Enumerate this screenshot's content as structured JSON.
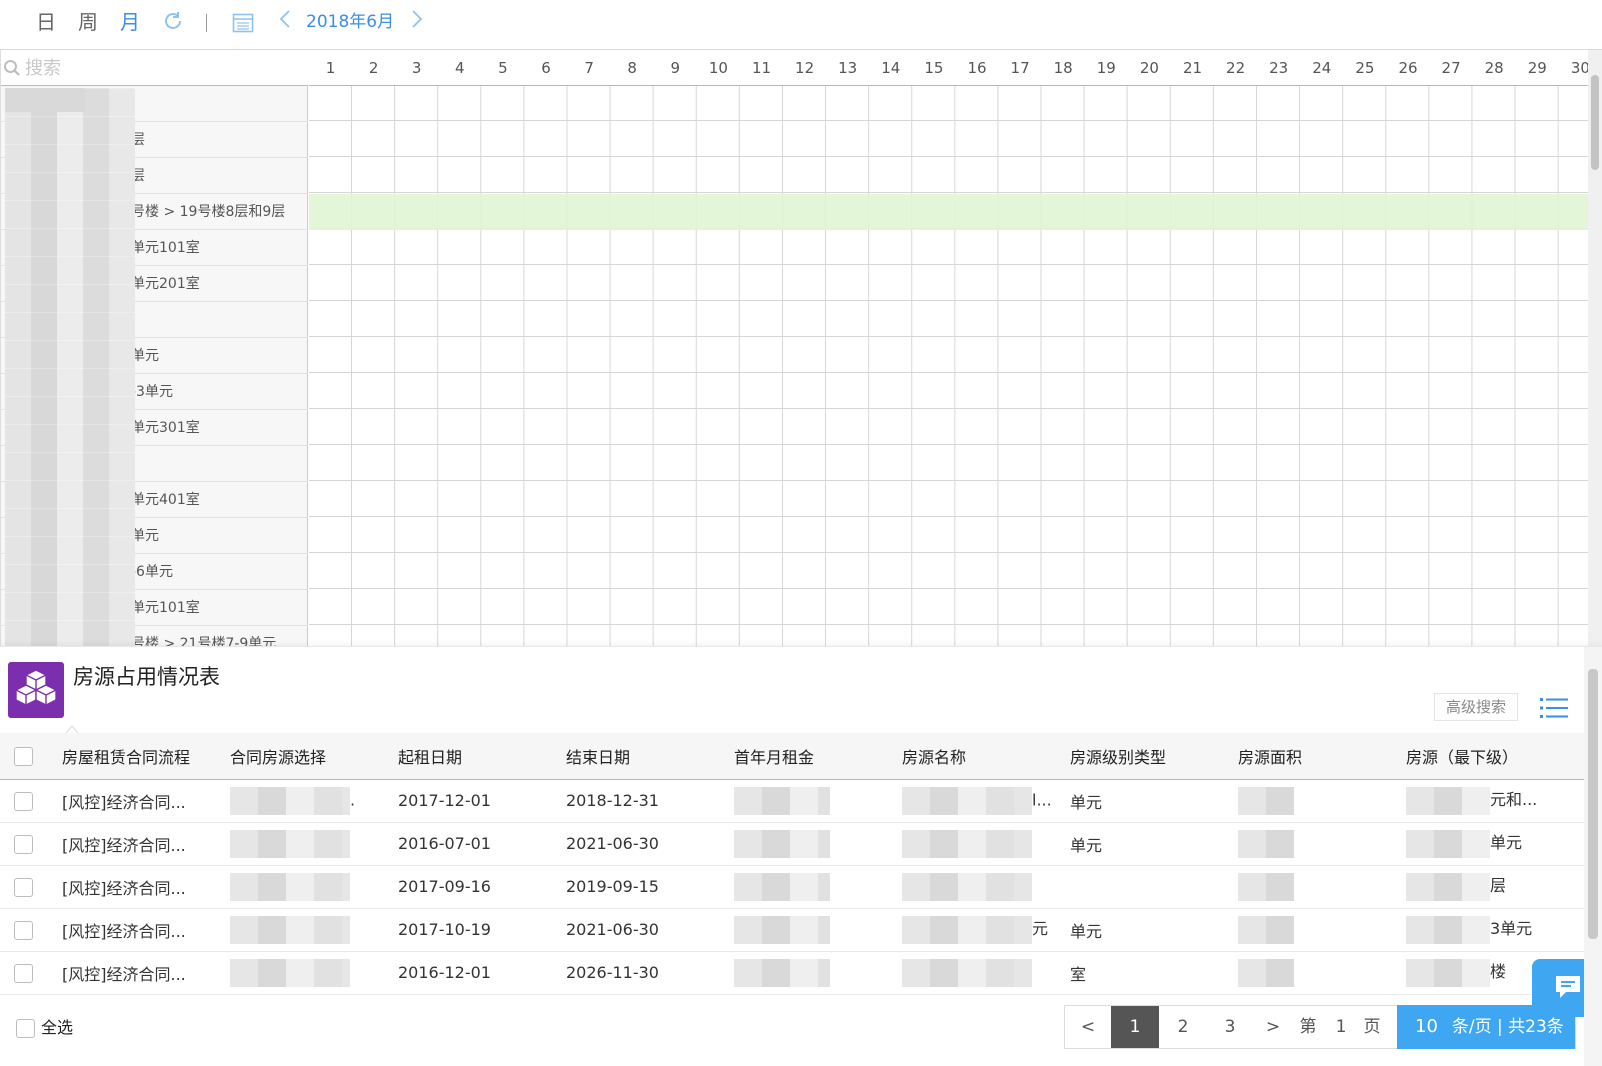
{
  "toolbar": {
    "view_day": "日",
    "view_week": "周",
    "view_month": "月",
    "month_label": "2018年6月",
    "prev": "‹",
    "next": "›"
  },
  "calendar": {
    "search_placeholder": "搜索",
    "days": [
      "1",
      "2",
      "3",
      "4",
      "5",
      "6",
      "7",
      "8",
      "9",
      "10",
      "11",
      "12",
      "13",
      "14",
      "15",
      "16",
      "17",
      "18",
      "19",
      "20",
      "21",
      "22",
      "23",
      "24",
      "25",
      "26",
      "27",
      "28",
      "29",
      "30"
    ],
    "rows": [
      "",
      "层",
      "层",
      "号楼 > 19号楼8层和9层",
      "单元101室",
      "单元201室",
      "",
      "单元",
      "-3单元",
      "单元301室",
      "",
      "单元401室",
      "单元",
      "-6单元",
      "单元101室",
      "号楼 > 21号楼7-9单元"
    ]
  },
  "panel": {
    "title": "房源占用情况表",
    "advanced_search": "高级搜索",
    "columns": [
      "房屋租赁合同流程",
      "合同房源选择",
      "起租日期",
      "结束日期",
      "首年月租金",
      "房源名称",
      "房源级别类型",
      "房源面积",
      "房源（最下级）"
    ],
    "rows": [
      {
        "flow": "[风控]经济合同...",
        "select_tail": ".",
        "start": "2017-12-01",
        "end": "2018-12-31",
        "name_tail": "l...",
        "level": "单元",
        "unit_tail": "元和..."
      },
      {
        "flow": "[风控]经济合同...",
        "select_tail": "",
        "start": "2016-07-01",
        "end": "2021-06-30",
        "name_tail": "",
        "level": "单元",
        "unit_tail": "单元"
      },
      {
        "flow": "[风控]经济合同...",
        "select_tail": "",
        "start": "2017-09-16",
        "end": "2019-09-15",
        "name_tail": "",
        "level": "",
        "unit_tail": "层"
      },
      {
        "flow": "[风控]经济合同...",
        "select_tail": "",
        "start": "2017-10-19",
        "end": "2021-06-30",
        "name_tail": "元",
        "level": "单元",
        "unit_tail": "3单元"
      },
      {
        "flow": "[风控]经济合同...",
        "select_tail": "",
        "start": "2016-12-01",
        "end": "2026-11-30",
        "name_tail": "",
        "level": "室",
        "unit_tail": "楼"
      }
    ],
    "select_all": "全选",
    "pager": {
      "prev": "<",
      "pages": [
        "1",
        "2",
        "3"
      ],
      "next": ">",
      "goto_prefix": "第",
      "goto_value": "1",
      "goto_suffix": "页",
      "page_size": "10",
      "size_summary": "条/页 | 共23条"
    }
  },
  "colors": {
    "accent": "#3a8ee6",
    "highlight_row": "#e0f5d4",
    "panel_icon": "#7b2fae",
    "pager_active": "#3fa6f1"
  }
}
